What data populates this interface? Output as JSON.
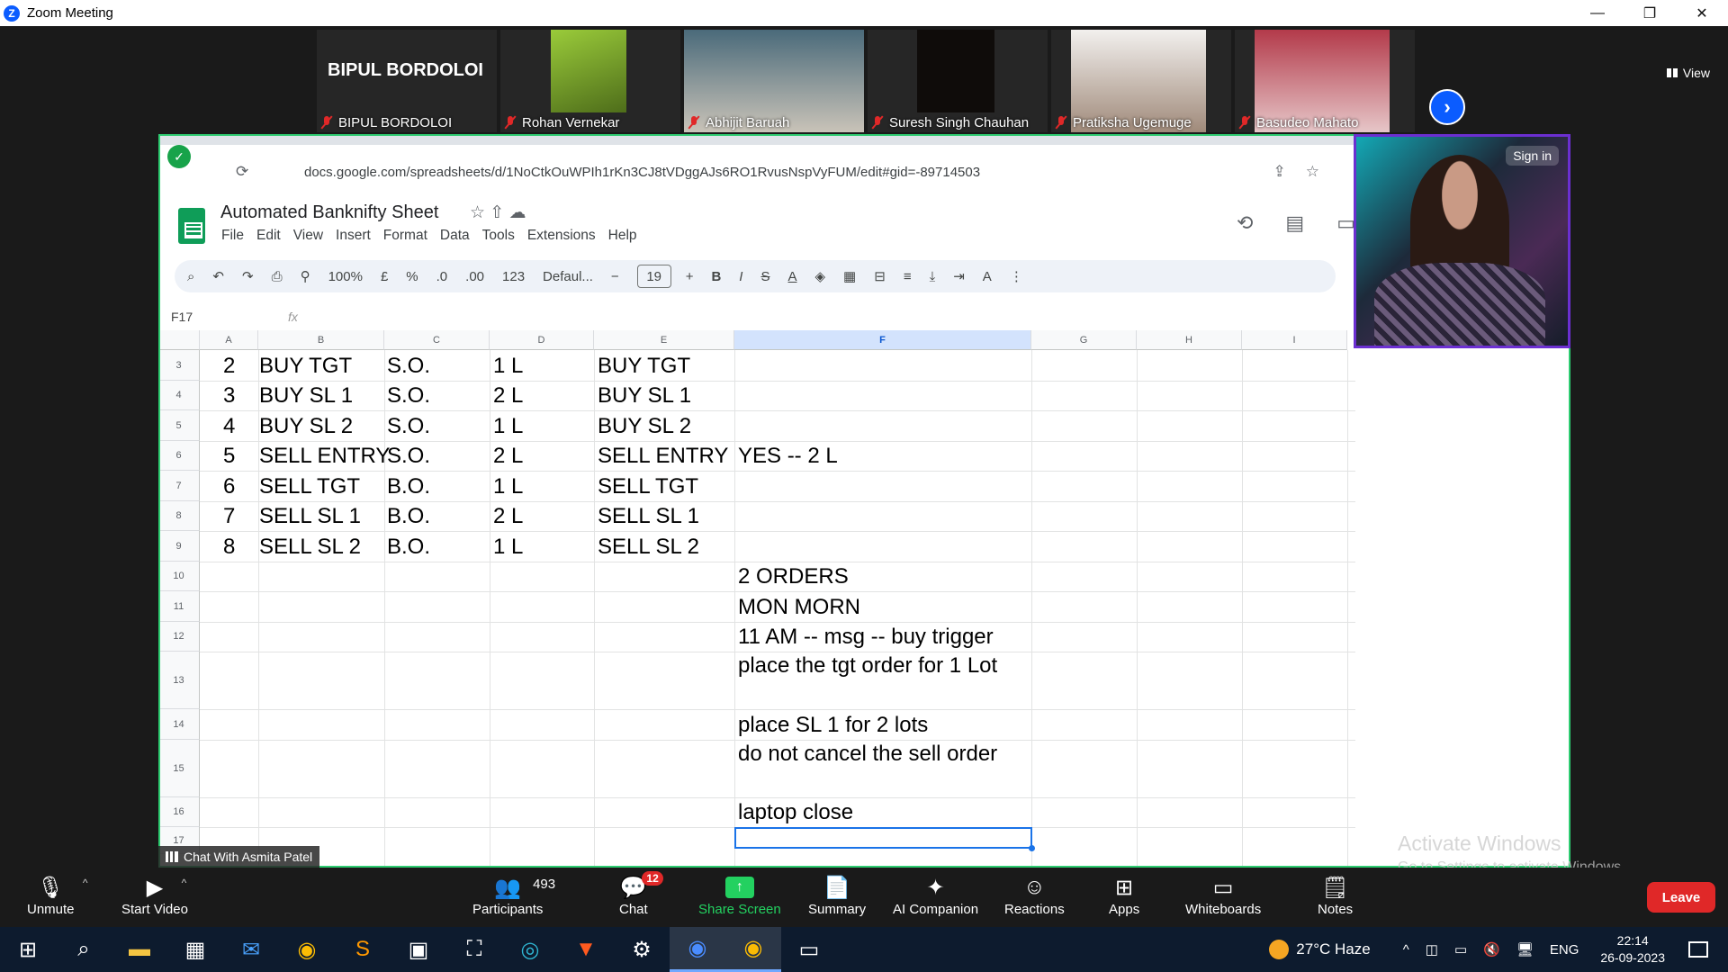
{
  "window": {
    "title": "Zoom Meeting",
    "controls": [
      "—",
      "❐",
      "✕"
    ]
  },
  "gallery": {
    "tiles": [
      {
        "name": "BIPUL BORDOLOI",
        "big_name": "BIPUL BORDOLOI"
      },
      {
        "name": "Rohan Vernekar"
      },
      {
        "name": "Abhijit Baruah"
      },
      {
        "name": "Suresh Singh Chauhan"
      },
      {
        "name": "Pratiksha Ugemuge"
      },
      {
        "name": "Basudeo Mahato"
      }
    ],
    "view_label": "View"
  },
  "browser": {
    "url": "docs.google.com/spreadsheets/d/1NoCtkOuWPIh1rKn3CJ8tVDggAJs6RO1RvusNspVyFUM/edit#gid=-89714503"
  },
  "sheet": {
    "title": "Automated Banknifty Sheet",
    "menu": [
      "File",
      "Edit",
      "View",
      "Insert",
      "Format",
      "Data",
      "Tools",
      "Extensions",
      "Help"
    ],
    "toolbar": {
      "zoom": "100%",
      "currency": "£",
      "percent": "%",
      "dec_minus": ".0",
      "dec_plus": ".00",
      "num_format": "123",
      "font": "Defaul...",
      "font_size": "19"
    },
    "cell_ref": "F17",
    "fx": "fx",
    "columns": [
      "A",
      "B",
      "C",
      "D",
      "E",
      "F",
      "G",
      "H",
      "I"
    ],
    "row_numbers": [
      "3",
      "4",
      "5",
      "6",
      "7",
      "8",
      "9",
      "10",
      "11",
      "12",
      "13",
      "14",
      "15",
      "16",
      "17"
    ],
    "rows": [
      {
        "a": "2",
        "b": "BUY TGT",
        "c": "S.O.",
        "d": "1 L",
        "e": "BUY TGT",
        "f": ""
      },
      {
        "a": "3",
        "b": "BUY SL 1",
        "c": "S.O.",
        "d": "2 L",
        "e": "BUY SL 1",
        "f": ""
      },
      {
        "a": "4",
        "b": "BUY SL 2",
        "c": "S.O.",
        "d": "1 L",
        "e": "BUY SL 2",
        "f": ""
      },
      {
        "a": "5",
        "b": "SELL ENTRY",
        "c": "S.O.",
        "d": "2 L",
        "e": "SELL ENTRY",
        "f": "YES -- 2 L"
      },
      {
        "a": "6",
        "b": "SELL TGT",
        "c": "B.O.",
        "d": "1 L",
        "e": "SELL TGT",
        "f": ""
      },
      {
        "a": "7",
        "b": "SELL SL 1",
        "c": "B.O.",
        "d": "2 L",
        "e": "SELL SL 1",
        "f": ""
      },
      {
        "a": "8",
        "b": "SELL SL 2",
        "c": "B.O.",
        "d": "1 L",
        "e": "SELL SL 2",
        "f": ""
      }
    ],
    "notes": [
      "2 ORDERS",
      "MON MORN",
      "11 AM -- msg -- buy trigger",
      "place the tgt order for 1 Lot",
      "place SL 1 for 2 lots",
      "do not cancel the sell order",
      "laptop close"
    ]
  },
  "presenter": {
    "signin": "Sign in"
  },
  "chat_with": "Chat With Asmita Patel",
  "activate": {
    "line1": "Activate Windows",
    "line2": "Go to Settings to activate Windows."
  },
  "controls": {
    "unmute": "Unmute",
    "start_video": "Start Video",
    "participants": "Participants",
    "participants_count": "493",
    "chat": "Chat",
    "chat_badge": "12",
    "share_screen": "Share Screen",
    "summary": "Summary",
    "ai_companion": "AI Companion",
    "reactions": "Reactions",
    "apps": "Apps",
    "whiteboards": "Whiteboards",
    "notes": "Notes",
    "leave": "Leave"
  },
  "taskbar": {
    "weather": "27°C  Haze",
    "lang": "ENG",
    "time": "22:14",
    "date": "26-09-2023"
  },
  "colors": {
    "zoom_blue": "#0b5cff",
    "leave_red": "#e02828",
    "share_green": "#23d160",
    "sheets_green": "#0f9d58",
    "selection_blue": "#1a73e8"
  }
}
